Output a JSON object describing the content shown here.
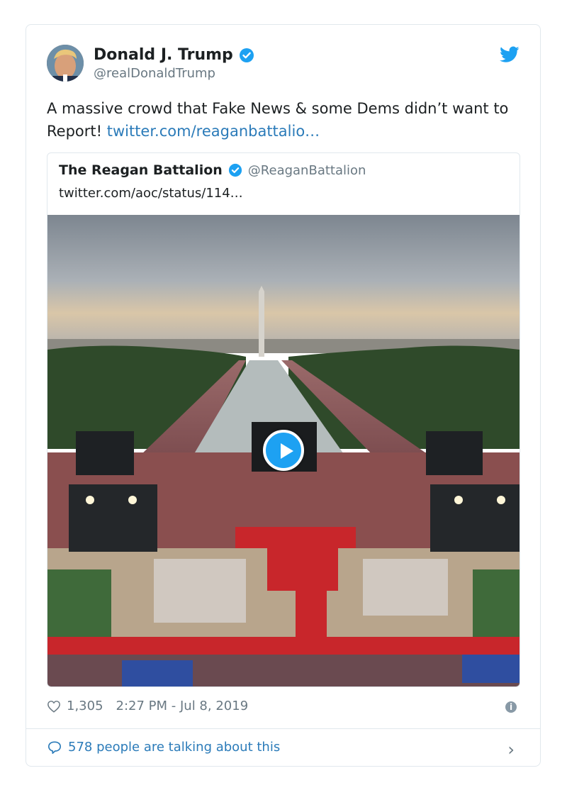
{
  "tweet": {
    "author_name": "Donald J. Trump",
    "author_handle": "@realDonaldTrump",
    "text_plain": "A massive crowd that Fake News & some Dems didn’t want to Report! ",
    "text_link": "twitter.com/reaganbattalio…",
    "likes": "1,305",
    "timestamp": "2:27 PM - Jul 8, 2019",
    "talking": "578 people are talking about this"
  },
  "quoted": {
    "name": "The Reagan Battalion",
    "handle": "@ReaganBattalion",
    "text": "twitter.com/aoc/status/114…"
  },
  "icons": {
    "verified": "verified-badge-icon",
    "bird": "twitter-bird-icon",
    "heart": "heart-icon",
    "info": "info-icon",
    "reply": "speech-bubble-icon",
    "chevron": "chevron-right-icon",
    "play": "play-icon"
  },
  "colors": {
    "accent": "#1da1f2",
    "link": "#2b7bb9",
    "muted": "#697882",
    "border": "#e1e8ed"
  }
}
